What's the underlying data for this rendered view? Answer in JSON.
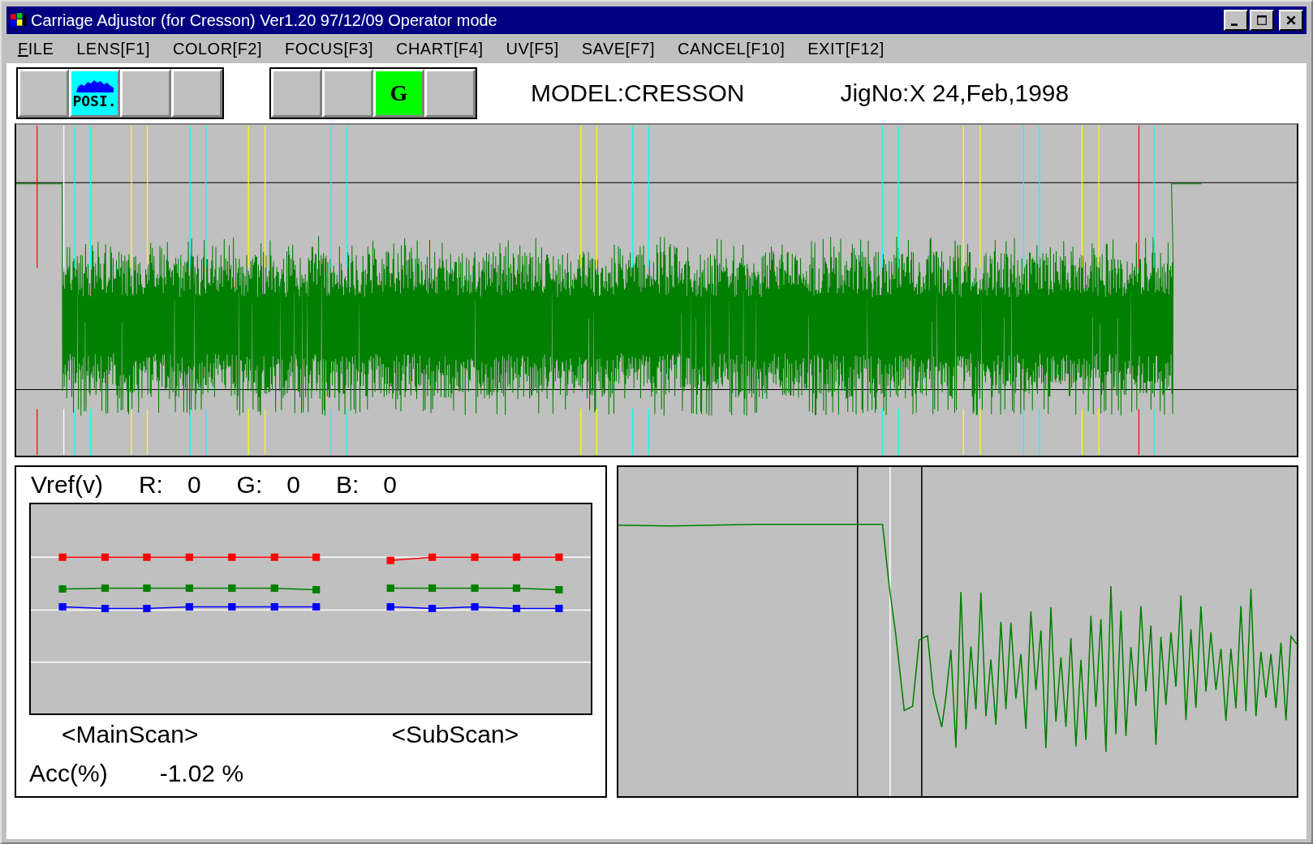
{
  "window": {
    "title": "Carriage Adjustor (for Cresson) Ver1.20 97/12/09 Operator mode"
  },
  "menu": [
    {
      "label": "FILE",
      "underlined": true
    },
    {
      "label": "LENS[F1]",
      "underlined": false
    },
    {
      "label": "COLOR[F2]",
      "underlined": false
    },
    {
      "label": "FOCUS[F3]",
      "underlined": false
    },
    {
      "label": "CHART[F4]",
      "underlined": false
    },
    {
      "label": "UV[F5]",
      "underlined": false
    },
    {
      "label": "SAVE[F7]",
      "underlined": false
    },
    {
      "label": "CANCEL[F10]",
      "underlined": false
    },
    {
      "label": "EXIT[F12]",
      "underlined": false
    }
  ],
  "toolbar": {
    "groups": [
      [
        {
          "kind": "blank"
        },
        {
          "kind": "posi",
          "label": "POSI."
        },
        {
          "kind": "blank"
        },
        {
          "kind": "blank"
        }
      ],
      [
        {
          "kind": "blank"
        },
        {
          "kind": "blank"
        },
        {
          "kind": "letter",
          "label": "G"
        },
        {
          "kind": "blank"
        }
      ]
    ],
    "model": "MODEL:CRESSON",
    "jig": "JigNo:X 24,Feb,1998"
  },
  "vref_panel": {
    "title": "Vref(v)",
    "values": [
      {
        "label": "R:",
        "value": "0"
      },
      {
        "label": "G:",
        "value": "0"
      },
      {
        "label": "B:",
        "value": "0"
      }
    ],
    "scan_labels": [
      "<MainScan>",
      "<SubScan>"
    ],
    "acc_label": "Acc(%)",
    "acc_value": "-1.02 %"
  }
}
